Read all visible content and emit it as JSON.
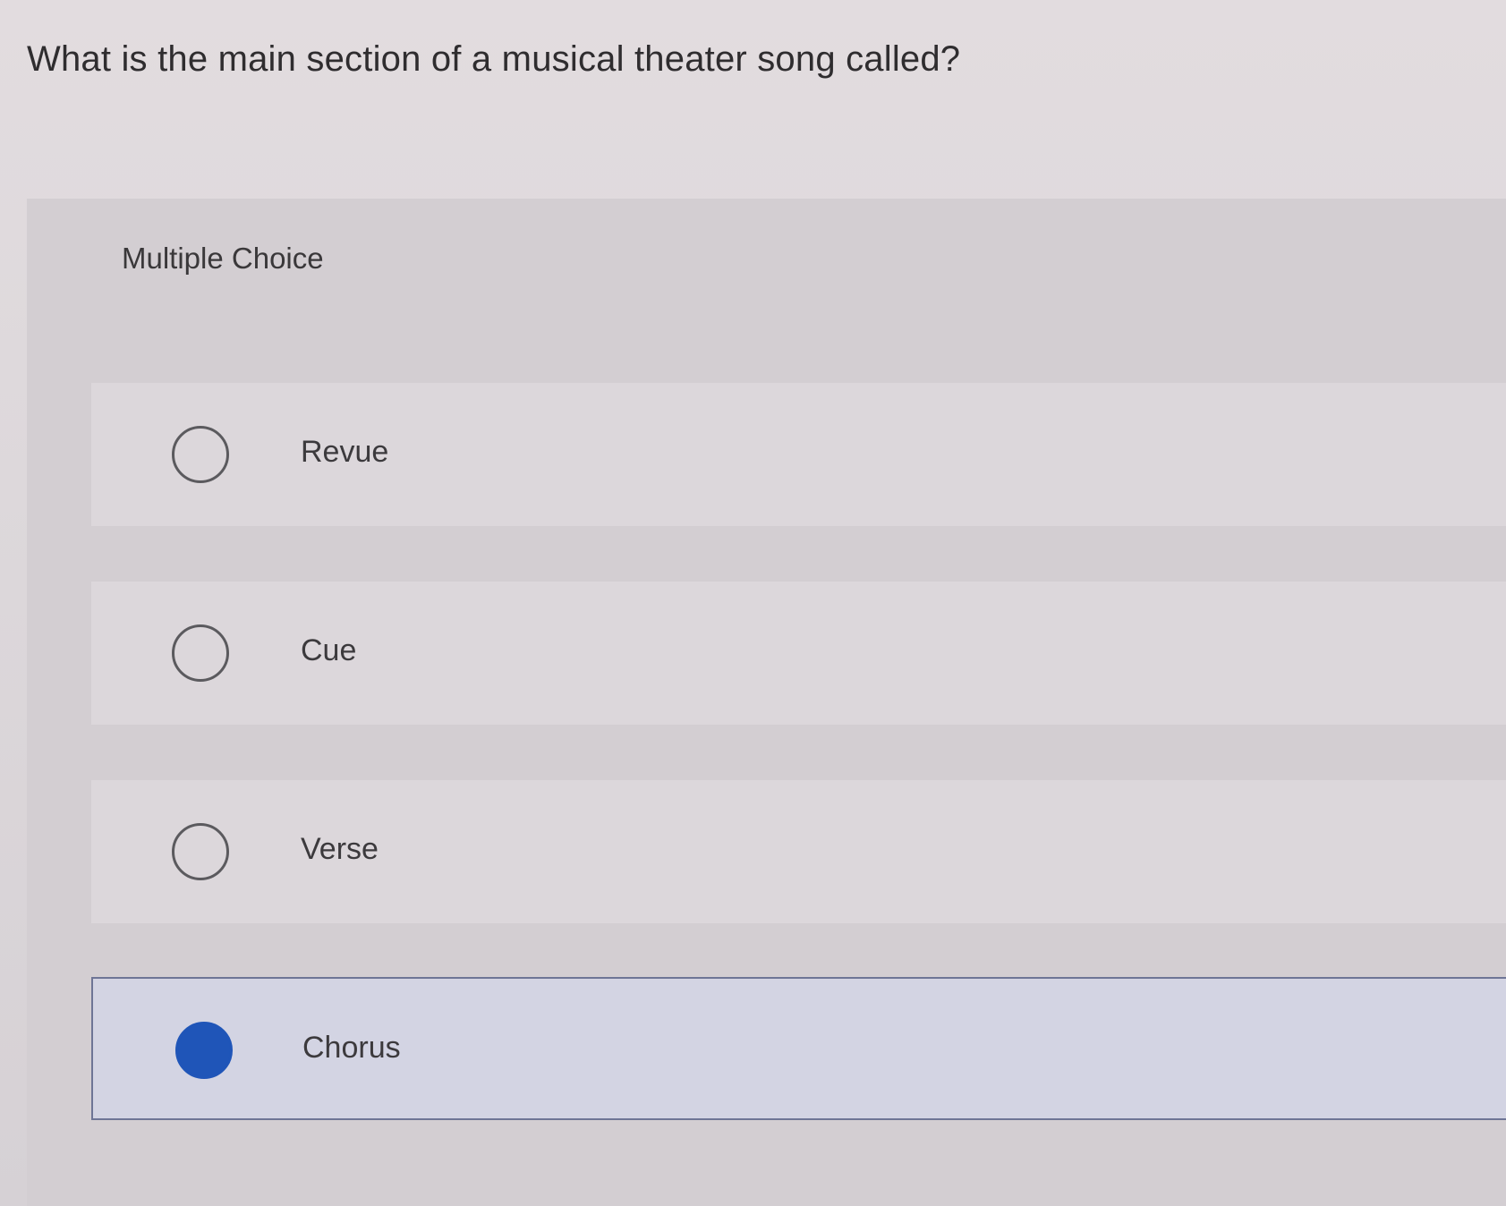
{
  "question": {
    "text": "What is the main section of a musical theater song called?"
  },
  "multiple_choice": {
    "label": "Multiple Choice",
    "options": [
      {
        "label": "Revue",
        "selected": false
      },
      {
        "label": "Cue",
        "selected": false
      },
      {
        "label": "Verse",
        "selected": false
      },
      {
        "label": "Chorus",
        "selected": true
      }
    ]
  },
  "colors": {
    "selected_radio": "#1f55b8",
    "selected_background": "#d3d4e3"
  }
}
